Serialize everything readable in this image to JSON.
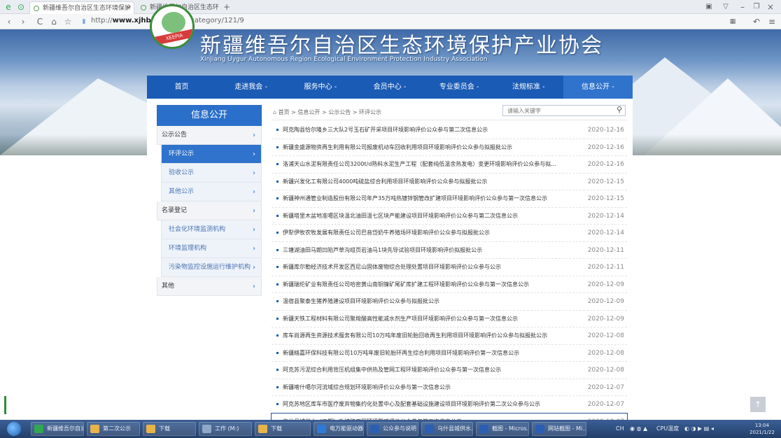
{
  "browser": {
    "tabs": [
      {
        "label": "新疆维吾尔自治区生态环境保护",
        "active": true
      },
      {
        "label": "新疆维吾尔自治区生态环境保护",
        "active": false
      }
    ],
    "new_tab": "+",
    "url_prefix": "http://",
    "url_domain": "www.xjhbcy.cn",
    "url_path": "/blog/category/121/9",
    "window_controls": [
      "minimize",
      "restore",
      "close"
    ]
  },
  "header": {
    "site_title": "新疆维吾尔自治区生态环境保护产业协会",
    "site_subtitle": "Xinjiang Uygur Autonomous Region Ecological Environment Protection Industry Association",
    "logo_text": "XEEPIA"
  },
  "nav": {
    "items": [
      {
        "label": "首页",
        "active": false
      },
      {
        "label": "走进我会 -",
        "active": false
      },
      {
        "label": "服务中心 -",
        "active": false
      },
      {
        "label": "会员中心 -",
        "active": false
      },
      {
        "label": "专业委员会 -",
        "active": false
      },
      {
        "label": "法规标准 -",
        "active": false
      },
      {
        "label": "信息公开 -",
        "active": true
      }
    ]
  },
  "sidebar": {
    "title": "信息公开",
    "groups": [
      {
        "label": "公示公告",
        "children": [
          {
            "label": "环评公示",
            "active": true
          },
          {
            "label": "验收公示",
            "active": false
          },
          {
            "label": "其他公示",
            "active": false
          }
        ]
      },
      {
        "label": "名录登记",
        "children": [
          {
            "label": "社会化环境监测机构",
            "active": false
          },
          {
            "label": "环境监理机构",
            "active": false
          },
          {
            "label": "污染物监控设施运行维护机构",
            "active": false
          }
        ]
      },
      {
        "label": "其他",
        "children": []
      }
    ]
  },
  "breadcrumb": "首页 > 信息公开 > 公示公告 > 环评公示",
  "search": {
    "placeholder": "请输入关键字"
  },
  "list": [
    {
      "title": "阿克陶县恰尔隆乡三大队2号玉石矿开采项目环境影响评价公众参与第二次信息公示",
      "date": "2020-12-16"
    },
    {
      "title": "新疆金盛源物资再生利用有限公司报废机动车回收利用项目环境影响评价公众参与拟报批公示",
      "date": "2020-12-16"
    },
    {
      "title": "洛浦天山水泥有限责任公司3200t/d熟料水泥生产工程（配套纯低温余热发电）变更环境影响评价公众参与拟...",
      "date": "2020-12-16"
    },
    {
      "title": "新疆兴发化工有限公司4000吨硫盐综合利用项目环境影响评价公众参与拟报批公示",
      "date": "2020-12-15"
    },
    {
      "title": "新疆神州通管业制造股份有限公司年产35万吨热镀锌钢管改扩建项目环境影响评价公众参与第一次信息公示",
      "date": "2020-12-15"
    },
    {
      "title": "新疆塔里木盆地准噶区块温北油田温七区块产能建设项目环境影响评价公众参与第二次信息公示",
      "date": "2020-12-14"
    },
    {
      "title": "伊犁伊牧农牧发展有限责任公司巴音岱奶牛养殖场环境影响评价公众参与拟报批公示",
      "date": "2020-12-14"
    },
    {
      "title": "三塘湖油田马朗凹陷芦草沟组页岩油马1块先导试验项目环境影响评价拟报批公示",
      "date": "2020-12-11"
    },
    {
      "title": "新疆库尔勒经济技术开发区西尼山固体废物综合处理处置项目环境影响评价公众参与公示",
      "date": "2020-12-11"
    },
    {
      "title": "新疆瑞伦矿业有限责任公司哈密黄山南铜镍矿尾矿库扩建工程环境影响评价公众参与第一次信息公示",
      "date": "2020-12-09"
    },
    {
      "title": "温宿县聚泰生猪养殖建设项目环境影响评价公众参与拟报批公示",
      "date": "2020-12-09"
    },
    {
      "title": "新疆天铁工程材料有限公司聚羧酸高性能减水剂生产项目环境影响评价公众参与第一次信息公示",
      "date": "2020-12-09"
    },
    {
      "title": "库车尚源再生资源技术服务有限公司10万吨年废旧轮胎回收再生利用项目环境影响评价公众参与拟报批公示",
      "date": "2020-12-08"
    },
    {
      "title": "新疆絡嘉环保科技有限公司10万吨年废旧轮胎环再生综合利用项目环境影响评价第一次信息公示",
      "date": "2020-12-08"
    },
    {
      "title": "阿克苏污泥综合利用背压机组集中供热及管网工程环境影响评价公众参与第一次信息公示",
      "date": "2020-12-08"
    },
    {
      "title": "新疆喀什噶尔河流域综合规划环境影响评价公众参与第一次信息公示",
      "date": "2020-12-07"
    },
    {
      "title": "阿克苏地区库车市医疗废弃物集约化处置中心及配套基础设施建设项目环境影响评价第二次公众参与公示",
      "date": "2020-12-07"
    },
    {
      "title": "乌什县城供水（二期）改扩建工程环境影响评价公众参与第二次信息公示",
      "date": "2020-12-07",
      "highlight": true
    }
  ],
  "taskbar": {
    "items": [
      {
        "label": "新疆维吾尔自治...",
        "icon_color": "#2fa84f"
      },
      {
        "label": "第二次公示",
        "icon_color": "#e8b44a"
      },
      {
        "label": "下载",
        "icon_color": "#e8b44a"
      },
      {
        "label": "工作 (M:)",
        "icon_color": "#8fa8c8"
      },
      {
        "label": "下载",
        "icon_color": "#e8b44a"
      },
      {
        "label": "电万能驱动器...",
        "icon_color": "#2d7ad6"
      },
      {
        "label": "公众参与说明 -...",
        "icon_color": "#2b5fb3"
      },
      {
        "label": "乌什县城供水...",
        "icon_color": "#2b5fb3"
      },
      {
        "label": "截图 - Micros...",
        "icon_color": "#2b5fb3"
      },
      {
        "label": "网站截图 - Mi...",
        "icon_color": "#2b5fb3"
      }
    ],
    "tray_text": "CH",
    "cpu_label": "CPU温度",
    "clock_time": "13:04",
    "clock_date": "2021/1/22"
  }
}
